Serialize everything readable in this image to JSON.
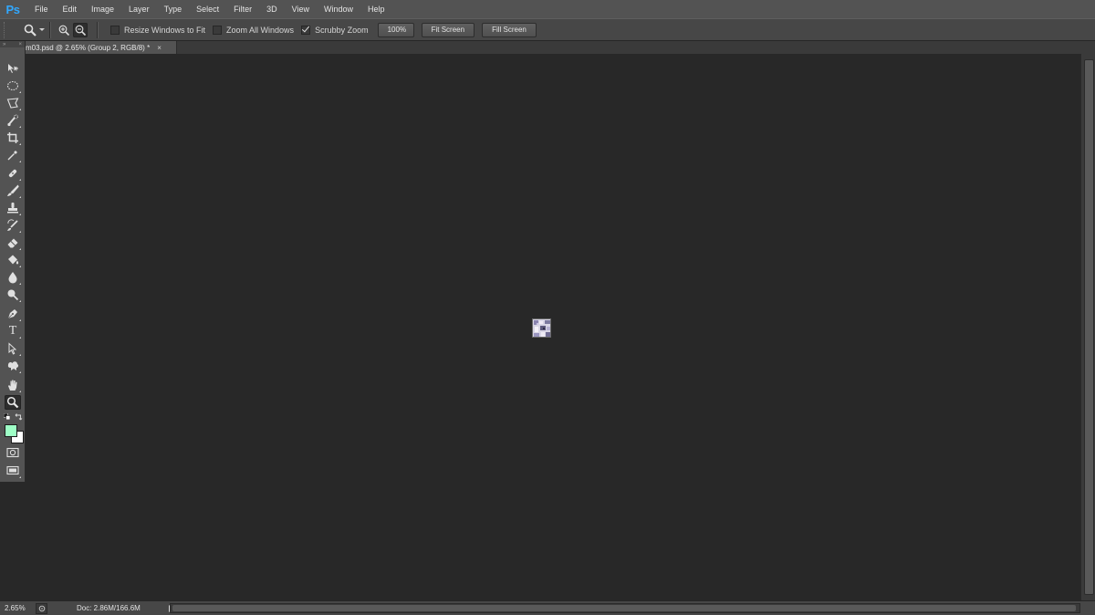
{
  "app": {
    "logo": "Ps"
  },
  "menu": [
    "File",
    "Edit",
    "Image",
    "Layer",
    "Type",
    "Select",
    "Filter",
    "3D",
    "View",
    "Window",
    "Help"
  ],
  "options": {
    "active_tool_icon": "zoom-icon",
    "zoom_in_icon": "zoom-in-icon",
    "zoom_out_icon": "zoom-out-icon",
    "zoom_out_selected": true,
    "resize_windows_label": "Resize Windows to Fit",
    "resize_windows_checked": false,
    "zoom_all_label": "Zoom All Windows",
    "zoom_all_checked": false,
    "scrubby_zoom_label": "Scrubby Zoom",
    "scrubby_zoom_checked": true,
    "hundred_label": "100%",
    "fit_screen_label": "Fit Screen",
    "fill_screen_label": "Fill Screen"
  },
  "toolbar": {
    "collapse_glyph": "» ",
    "close_glyph": "×",
    "tools": [
      {
        "name": "move-tool-icon"
      },
      {
        "name": "elliptical-marquee-icon"
      },
      {
        "name": "polygonal-lasso-icon"
      },
      {
        "name": "quick-selection-icon"
      },
      {
        "name": "crop-tool-icon"
      },
      {
        "name": "eyedropper-icon"
      },
      {
        "name": "healing-brush-icon"
      },
      {
        "name": "brush-tool-icon"
      },
      {
        "name": "clone-stamp-icon"
      },
      {
        "name": "history-brush-icon"
      },
      {
        "name": "eraser-icon"
      },
      {
        "name": "paint-bucket-icon"
      },
      {
        "name": "blur-tool-icon"
      },
      {
        "name": "dodge-tool-icon"
      },
      {
        "name": "pen-tool-icon"
      },
      {
        "name": "type-tool-icon"
      },
      {
        "name": "path-selection-icon"
      },
      {
        "name": "custom-shape-icon"
      },
      {
        "name": "hand-tool-icon"
      },
      {
        "name": "zoom-tool-icon",
        "selected": true
      }
    ],
    "foreground_color": "#9effc6",
    "background_color": "#ffffff",
    "type_glyph": "T"
  },
  "document": {
    "tab_label": "m03.psd @ 2.65% (Group 2, RGB/8) *",
    "close_glyph": "×"
  },
  "status": {
    "zoom": "2.65%",
    "doc_info": "Doc: 2.86M/166.6M"
  },
  "colors": {
    "accent": "#31a8ff",
    "menubar_bg": "#535353",
    "canvas_bg": "#282828"
  }
}
